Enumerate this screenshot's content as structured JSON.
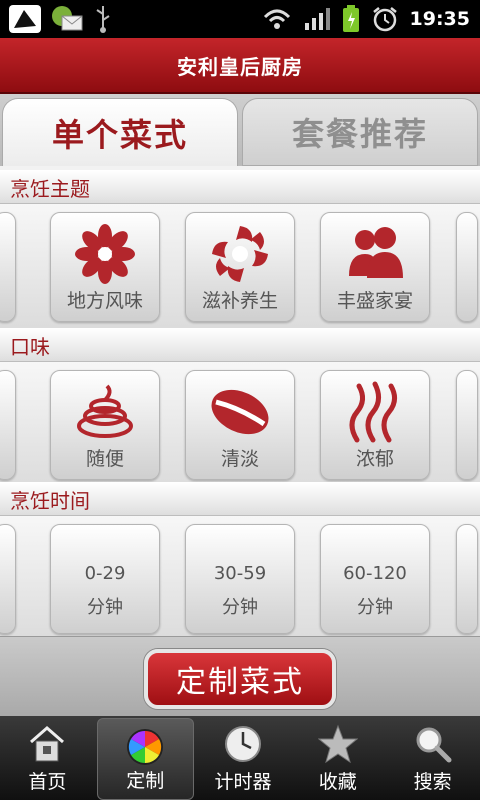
{
  "status": {
    "time": "19:35"
  },
  "title": "安利皇后厨房",
  "tabs": [
    {
      "label": "单个菜式"
    },
    {
      "label": "套餐推荐"
    }
  ],
  "sections": {
    "theme": {
      "title": "烹饪主题",
      "items": [
        "地方风味",
        "滋补养生",
        "丰盛家宴"
      ]
    },
    "taste": {
      "title": "口味",
      "items": [
        "随便",
        "清淡",
        "浓郁"
      ]
    },
    "time": {
      "title": "烹饪时间",
      "items": [
        {
          "range": "0-29",
          "unit": "分钟"
        },
        {
          "range": "30-59",
          "unit": "分钟"
        },
        {
          "range": "60-120",
          "unit": "分钟"
        }
      ]
    }
  },
  "action": {
    "label": "定制菜式"
  },
  "nav": [
    "首页",
    "定制",
    "计时器",
    "收藏",
    "搜索"
  ],
  "colors": {
    "brand": "#9b1a1e"
  }
}
